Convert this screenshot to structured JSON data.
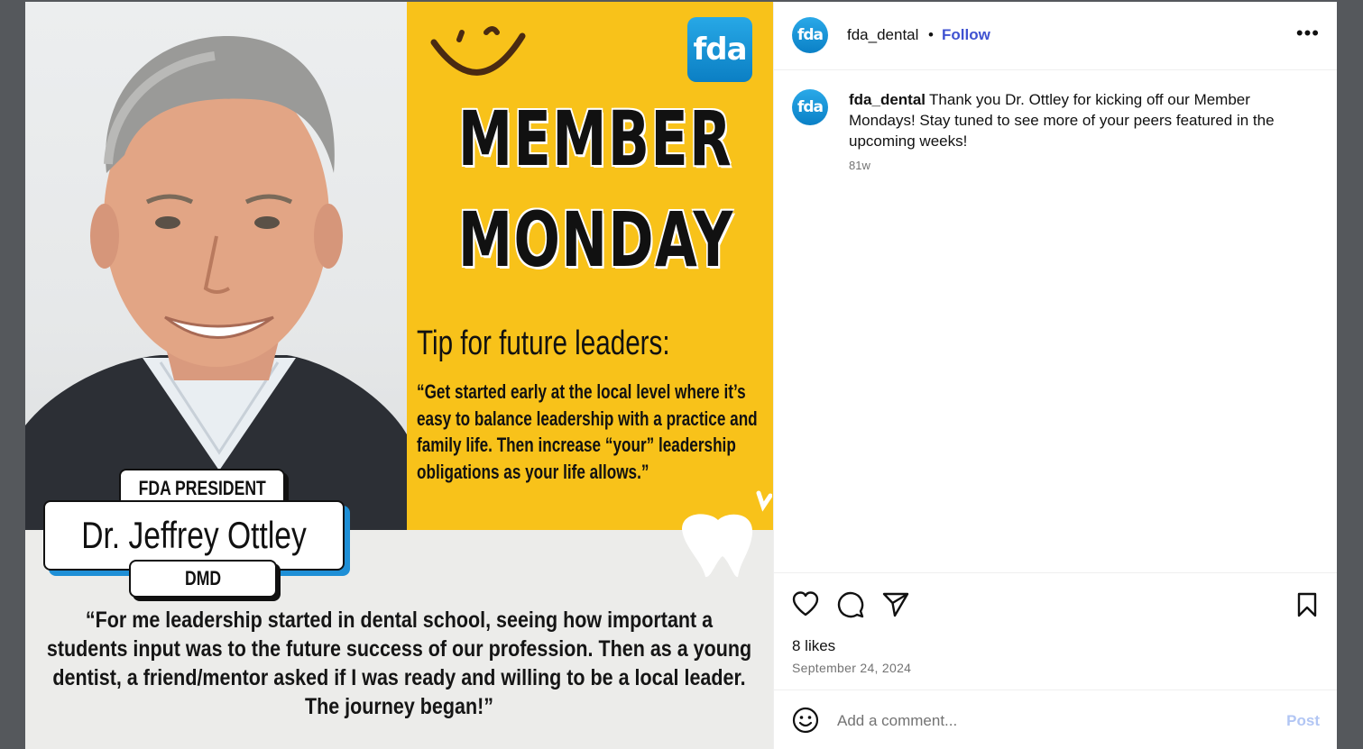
{
  "post_image": {
    "logo_text": "fda",
    "headline_line1": "MEMBER",
    "headline_line2": "MONDAY",
    "tip_title": "Tip for future leaders:",
    "tip_quote": "“Get started early at the local level where it’s easy to balance leadership with a practice and family life. Then increase “your” leadership obligations as your life allows.”",
    "role": "FDA PRESIDENT",
    "name": "Dr. Jeffrey Ottley",
    "degree": "DMD",
    "quote": "“For me leadership started in dental school, seeing how important a students input was to the future success of our profession. Then as a young dentist, a friend/mentor asked if I was ready and willing to be a local leader. The journey began!”",
    "colors": {
      "panel_yellow": "#f8c21a",
      "accent_blue": "#1e8fd6"
    }
  },
  "header": {
    "avatar_text": "fda",
    "username": "fda_dental",
    "separator": "•",
    "follow_label": "Follow",
    "more_label": "•••"
  },
  "caption": {
    "avatar_text": "fda",
    "username": "fda_dental",
    "text": "Thank you Dr. Ottley for kicking off our Member Mondays! Stay tuned to see more of your peers featured in the upcoming weeks!",
    "timestamp": "81w"
  },
  "actions": {
    "icons": [
      "heart-icon",
      "comment-icon",
      "share-icon",
      "bookmark-icon"
    ],
    "likes": "8 likes",
    "date": "September 24, 2024"
  },
  "comment": {
    "placeholder": "Add a comment...",
    "post_label": "Post"
  }
}
